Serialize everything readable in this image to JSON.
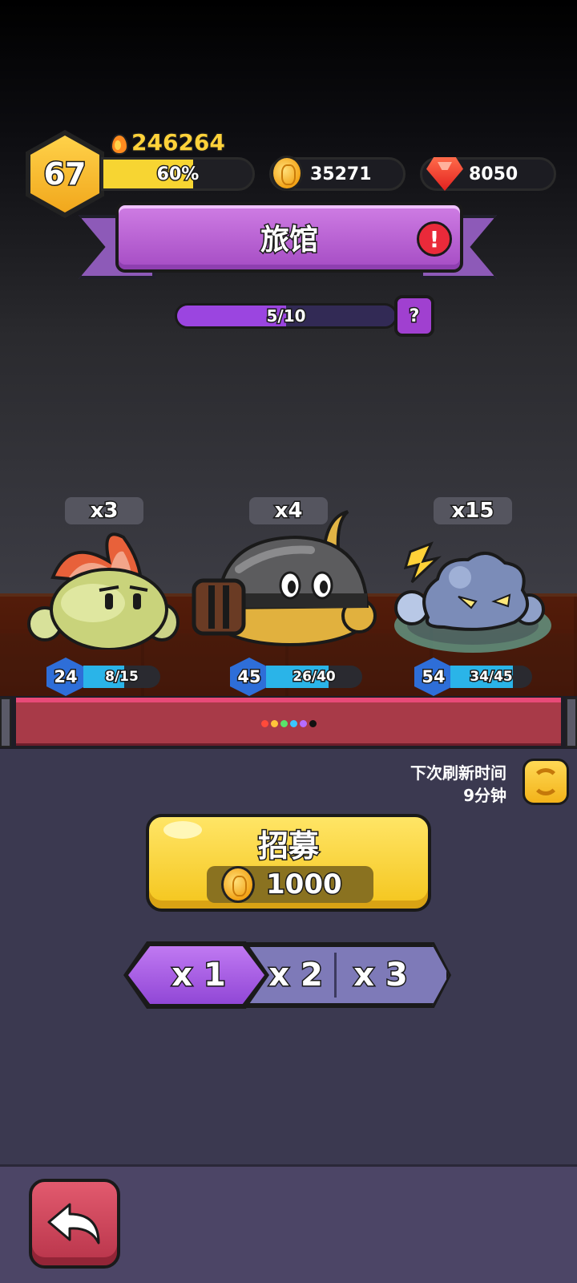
{
  "player": {
    "level": "67",
    "power": "246264",
    "xp_percent_label": "60%",
    "xp_fraction": 0.6
  },
  "currencies": {
    "gold": "35271",
    "gems": "8050"
  },
  "title": {
    "text": "旅馆"
  },
  "progress": {
    "label": "5/10",
    "fraction": 0.5,
    "help_label": "?"
  },
  "monsters": [
    {
      "count": "x3",
      "level": "24",
      "hp_label": "8/15",
      "hp_fraction": 0.53
    },
    {
      "count": "x4",
      "level": "45",
      "hp_label": "26/40",
      "hp_fraction": 0.65
    },
    {
      "count": "x15",
      "level": "54",
      "hp_label": "34/45",
      "hp_fraction": 0.76
    }
  ],
  "refresh": {
    "line1": "下次刷新时间",
    "line2": "9分钟"
  },
  "recruit": {
    "label": "招募",
    "cost": "1000"
  },
  "multiplier": {
    "options": [
      "x 1",
      "x 2",
      "x 3"
    ],
    "selected": "x 1"
  },
  "colors": {
    "accent_purple": "#a54cc4",
    "gold": "#f4c51c",
    "hp_blue": "#2ab4e8",
    "level_blue": "#2e6ed8",
    "alert_red": "#ea2a3a",
    "back_red": "#b8344a"
  },
  "icons": {
    "power": "fire-icon",
    "gold": "coin-icon",
    "gems": "gem-icon",
    "alert": "alert-icon",
    "help": "question-icon",
    "refresh": "refresh-icon",
    "back": "back-arrow-icon"
  }
}
